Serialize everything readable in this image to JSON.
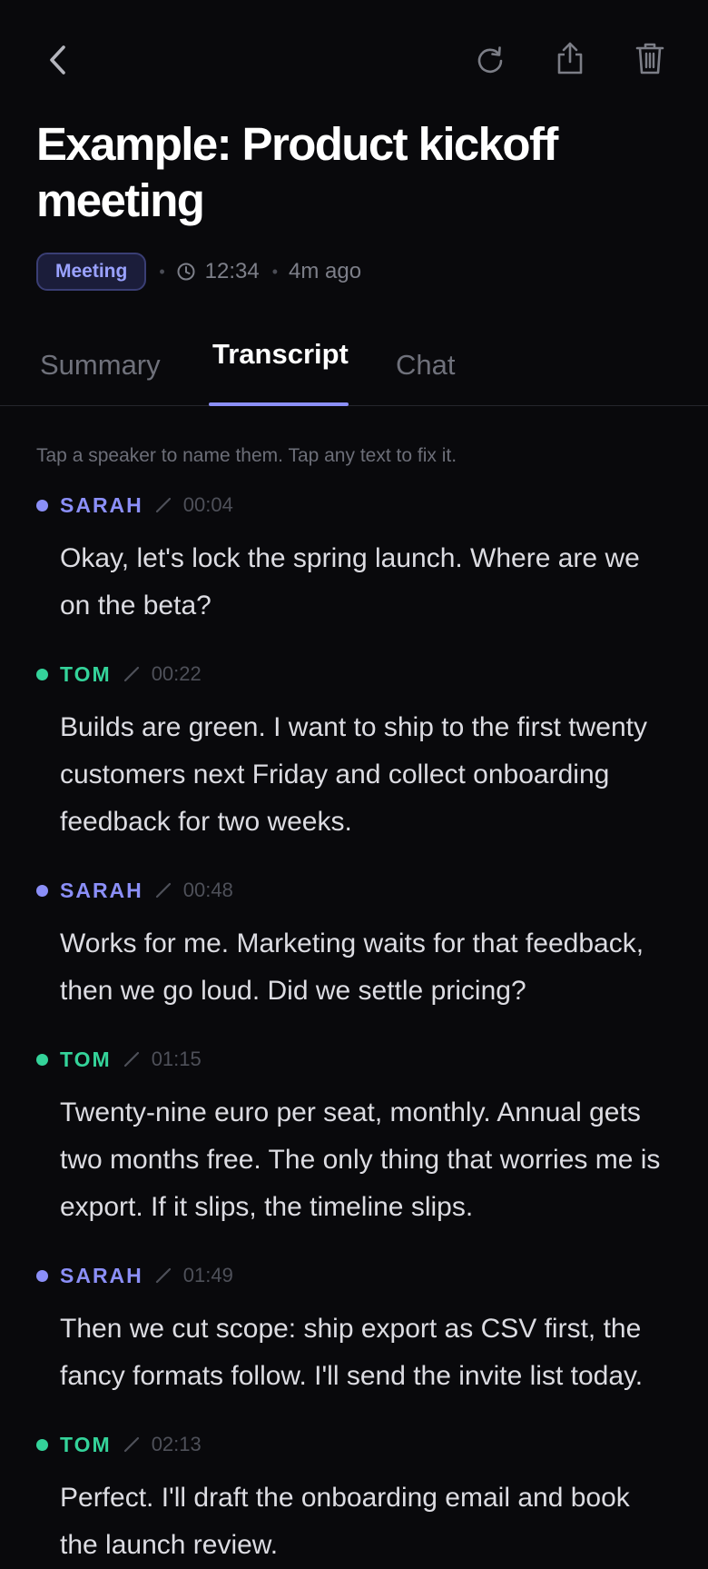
{
  "header": {
    "back_icon": "chevron-left-icon",
    "refresh_icon": "refresh-icon",
    "share_icon": "share-icon",
    "delete_icon": "trash-icon"
  },
  "meeting": {
    "title": "Example: Product kickoff meeting",
    "badge": "Meeting",
    "duration": "12:34",
    "created": "4m ago"
  },
  "tabs": [
    {
      "label": "Summary",
      "active": false
    },
    {
      "label": "Transcript",
      "active": true
    },
    {
      "label": "Chat",
      "active": false
    }
  ],
  "hint": "Tap a speaker to name them. Tap any text to fix it.",
  "colors": {
    "accent": "#8b8ff8",
    "speaker_sarah": "#8b8ff8",
    "speaker_tom": "#34d39a",
    "background": "#09090c"
  },
  "segments": [
    {
      "speaker": "SARAH",
      "time": "00:04",
      "text": "Okay, let's lock the spring launch. Where are we on the beta?"
    },
    {
      "speaker": "TOM",
      "time": "00:22",
      "text": "Builds are green. I want to ship to the first twenty customers next Friday and collect onboarding feedback for two weeks."
    },
    {
      "speaker": "SARAH",
      "time": "00:48",
      "text": "Works for me. Marketing waits for that feedback, then we go loud. Did we settle pricing?"
    },
    {
      "speaker": "TOM",
      "time": "01:15",
      "text": "Twenty-nine euro per seat, monthly. Annual gets two months free. The only thing that worries me is export. If it slips, the timeline slips."
    },
    {
      "speaker": "SARAH",
      "time": "01:49",
      "text": "Then we cut scope: ship export as CSV first, the fancy formats follow. I'll send the invite list today."
    },
    {
      "speaker": "TOM",
      "time": "02:13",
      "text": "Perfect. I'll draft the onboarding email and book the launch review."
    }
  ]
}
